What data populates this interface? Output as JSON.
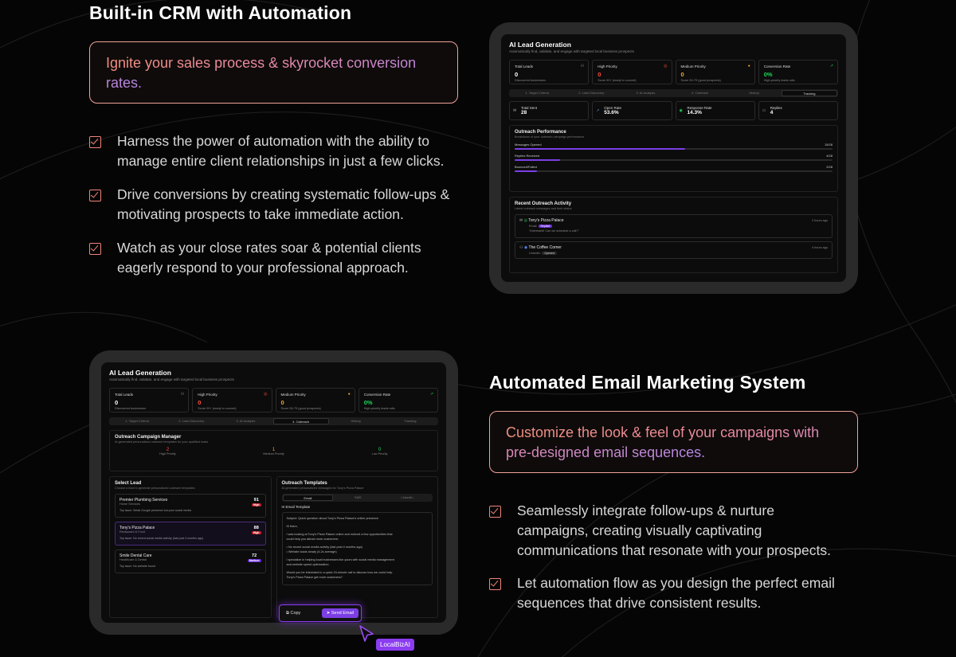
{
  "section1": {
    "title": "Built-in CRM with Automation",
    "tagline": "Ignite your sales process & skyrocket conversion rates.",
    "bullets": [
      "Harness the power of automation with the ability to manage entire client relationships in just a few clicks.",
      "Drive conversions by creating systematic follow-ups & motivating prospects to take immediate action.",
      "Watch as your close rates soar & potential clients eagerly respond to your professional approach."
    ]
  },
  "section2": {
    "title": "Automated Email Marketing System",
    "tagline": "Customize the look & feel of your campaigns with pre-designed email sequences.",
    "bullets": [
      "Seamlessly integrate follow-ups & nurture campaigns, creating visually captivating communications that resonate with your prospects.",
      "Let automation flow as you design the perfect email sequences that drive consistent results."
    ]
  },
  "app": {
    "title": "AI Lead Generation",
    "subtitle": "Automatically find, validate, and engage with targeted local business prospects",
    "stats": [
      {
        "label": "Total Leads",
        "value": "0",
        "desc": "Discovered businesses",
        "color": "#ffffff"
      },
      {
        "label": "High Priority",
        "value": "0",
        "desc": "Score 90+ (ready to convert)",
        "color": "#ff4d3d"
      },
      {
        "label": "Medium Priority",
        "value": "0",
        "desc": "Score 50-79 (good prospects)",
        "color": "#f5a623"
      },
      {
        "label": "Conversion Rate",
        "value": "0%",
        "desc": "High-priority leads ratio",
        "color": "#22d35a"
      }
    ],
    "tabs": [
      "1. Target Criteria",
      "2. Lead Discovery",
      "3. AI Analysis",
      "4. Outreach",
      "History",
      "Tracking"
    ]
  },
  "tracking": {
    "metrics": [
      {
        "label": "Total Sent",
        "value": "28"
      },
      {
        "label": "Open Rate",
        "value": "53.6%"
      },
      {
        "label": "Response Rate",
        "value": "14.3%"
      },
      {
        "label": "Replies",
        "value": "4"
      }
    ],
    "performance_title": "Outreach Performance",
    "performance_sub": "Breakdown of your outreach campaign performance",
    "bars": [
      {
        "label": "Messages Opened",
        "count": "15/28",
        "pct": 53.6
      },
      {
        "label": "Replies Received",
        "count": "4/28",
        "pct": 14.3
      },
      {
        "label": "Bounced/Failed",
        "count": "2/28",
        "pct": 7.1
      }
    ],
    "activity_title": "Recent Outreach Activity",
    "activity_sub": "Latest outreach messages and their status",
    "activity": [
      {
        "name": "Tony's Pizza Palace",
        "channel": "Email",
        "status": "Replied",
        "quote": "\"Interested! Can we schedule a call?\"",
        "time": "2 hours ago"
      },
      {
        "name": "The Coffee Corner",
        "channel": "LinkedIn",
        "status": "Opened",
        "quote": "",
        "time": "4 hours ago"
      }
    ]
  },
  "outreach": {
    "manager_title": "Outreach Campaign Manager",
    "manager_sub": "AI-generated personalized outreach templates for your qualified leads",
    "counts": [
      {
        "value": "2",
        "label": "High Priority",
        "color": "#ff4d3d"
      },
      {
        "value": "1",
        "label": "Medium Priority",
        "color": "#f5a623"
      },
      {
        "value": "0",
        "label": "Low Priority",
        "color": "#22d35a"
      }
    ],
    "select_title": "Select Lead",
    "select_sub": "Choose a lead to generate personalized outreach templates",
    "leads": [
      {
        "name": "Premier Plumbing Services",
        "category": "Home Services",
        "score": "91",
        "badge": "High",
        "opp": "Top issue: Weak Google presence but poor social media"
      },
      {
        "name": "Tony's Pizza Palace",
        "category": "Restaurant & Food",
        "score": "88",
        "badge": "High",
        "opp": "Top issue: No recent social media activity (last post 4 months ago)"
      },
      {
        "name": "Smile Dental Care",
        "category": "Healthcare & Dental",
        "score": "72",
        "badge": "Medium",
        "opp": "Top issue: No website found"
      }
    ],
    "templates_title": "Outreach Templates",
    "templates_sub": "AI-generated personalized messages for Tony's Pizza Palace",
    "template_tabs": [
      "Email",
      "SMS",
      "LinkedIn"
    ],
    "template_label": "Email Template",
    "email_lines": [
      "Subject: Quick question about Tony's Pizza Palace's online presence",
      "",
      "Hi there,",
      "",
      "I was looking at Tony's Pizza Palace online and noticed a few opportunities that",
      "could help you attract more customers:",
      "",
      "• No recent social media activity (last post 4 months ago)",
      "• Website loads slowly (4.2s average)",
      "",
      "I specialize in helping local businesses like yours with social media management",
      "and website speed optimization.",
      "",
      "Would you be interested in a quick 15-minute call to discuss how we could help",
      "Tony's Pizza Palace get more customers?"
    ],
    "copy_label": "Copy",
    "send_label": "Send Email",
    "brand": "LocalBizAI"
  }
}
